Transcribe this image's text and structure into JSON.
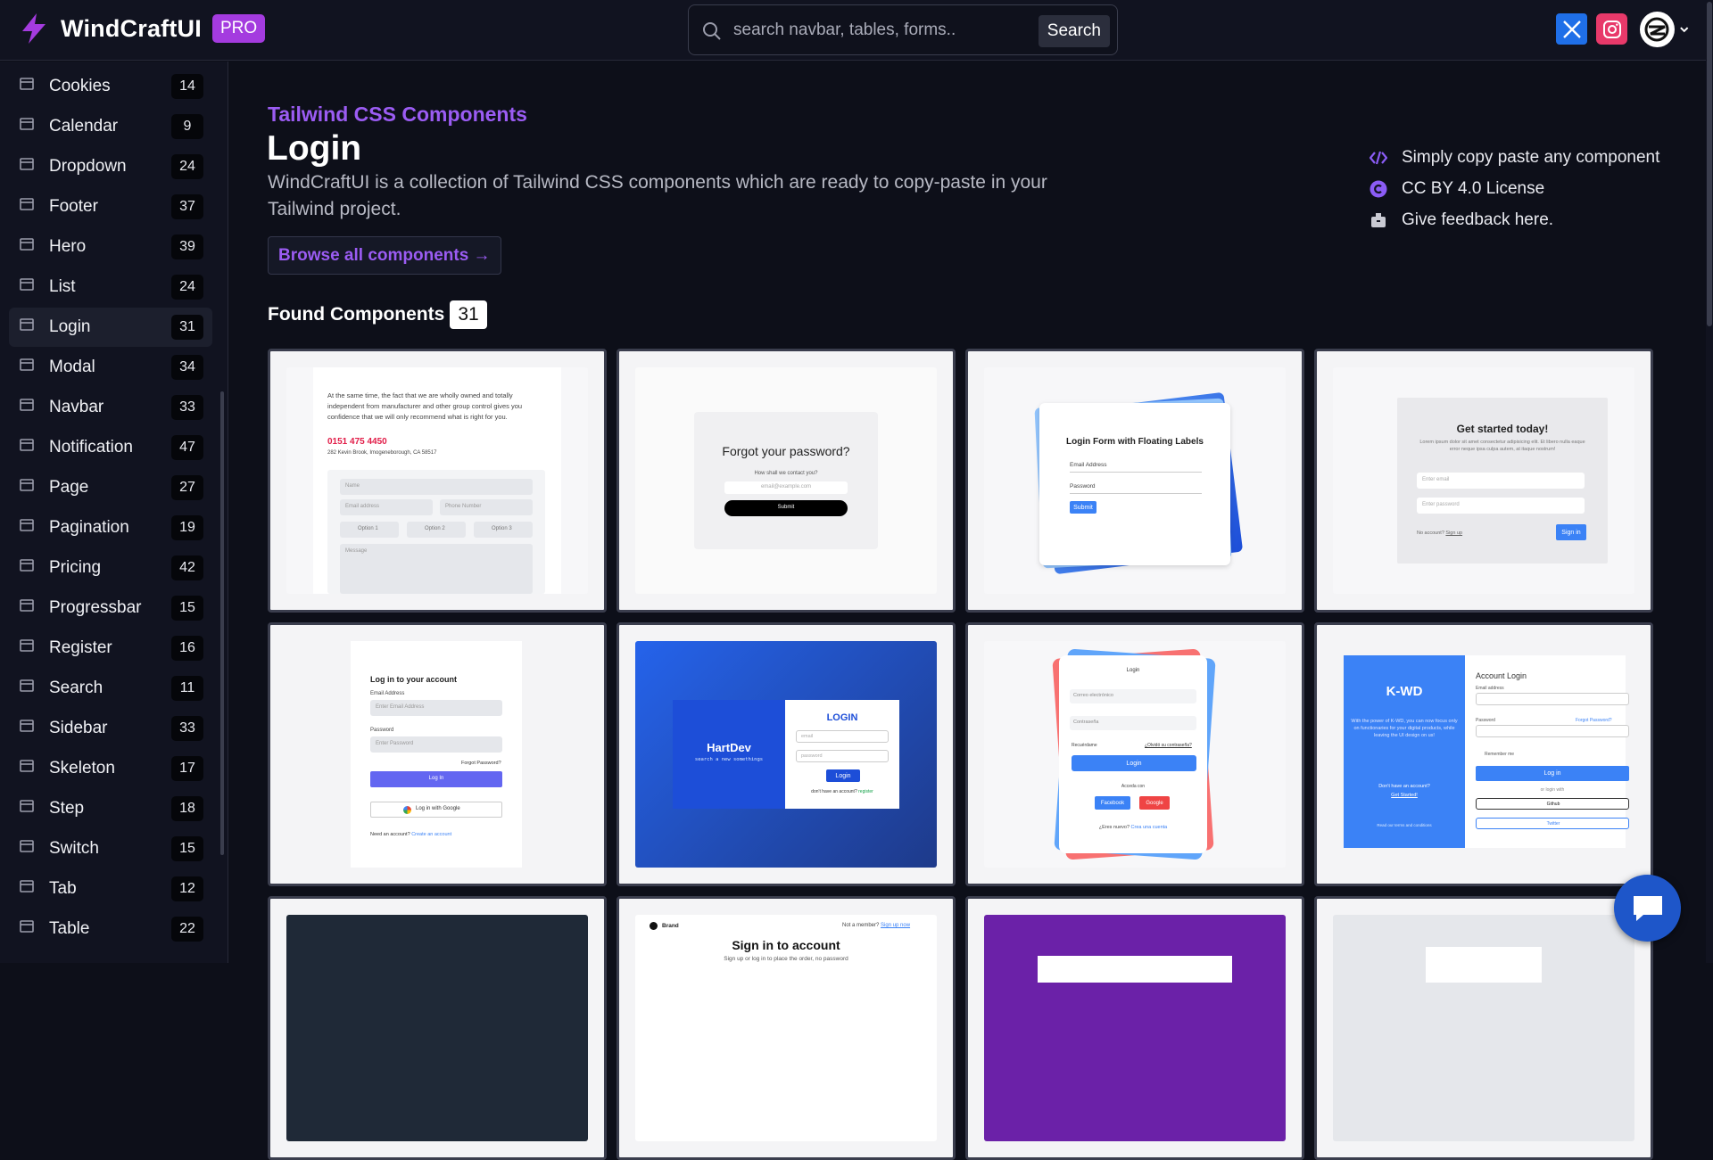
{
  "app": {
    "brand_name": "WindCraftUI",
    "pro_label": "PRO",
    "search_placeholder": "search navbar, tables, forms..",
    "search_button": "Search"
  },
  "sidebar": {
    "items": [
      {
        "label": "Cookies",
        "count": "14"
      },
      {
        "label": "Calendar",
        "count": "9"
      },
      {
        "label": "Dropdown",
        "count": "24"
      },
      {
        "label": "Footer",
        "count": "37"
      },
      {
        "label": "Hero",
        "count": "39"
      },
      {
        "label": "List",
        "count": "24"
      },
      {
        "label": "Login",
        "count": "31",
        "active": true
      },
      {
        "label": "Modal",
        "count": "34"
      },
      {
        "label": "Navbar",
        "count": "33"
      },
      {
        "label": "Notification",
        "count": "47"
      },
      {
        "label": "Page",
        "count": "27"
      },
      {
        "label": "Pagination",
        "count": "19"
      },
      {
        "label": "Pricing",
        "count": "42"
      },
      {
        "label": "Progressbar",
        "count": "15"
      },
      {
        "label": "Register",
        "count": "16"
      },
      {
        "label": "Search",
        "count": "11"
      },
      {
        "label": "Sidebar",
        "count": "33"
      },
      {
        "label": "Skeleton",
        "count": "17"
      },
      {
        "label": "Step",
        "count": "18"
      },
      {
        "label": "Switch",
        "count": "15"
      },
      {
        "label": "Tab",
        "count": "12"
      },
      {
        "label": "Table",
        "count": "22"
      }
    ]
  },
  "main": {
    "kicker": "Tailwind CSS Components",
    "title": "Login",
    "description": "WindCraftUI is a collection of Tailwind CSS components which are ready to copy-paste in your Tailwind project.",
    "browse_label": "Browse all components →",
    "features": [
      "Simply copy paste any component",
      "CC BY 4.0 License",
      "Give feedback here."
    ],
    "found_label": "Found Components",
    "found_count": "31"
  },
  "cards": {
    "c1": {
      "text": "At the same time, the fact that we are wholly owned and totally independent from manufacturer and other group control gives you confidence that we will only recommend what is right for you.",
      "phone": "0151 475 4450",
      "address": "282 Kevin Brook, Imogeneborough, CA 58517",
      "name": "Name",
      "email": "Email address",
      "phone_field": "Phone Number",
      "opt1": "Option 1",
      "opt2": "Option 2",
      "opt3": "Option 3",
      "message": "Message"
    },
    "c2": {
      "title": "Forgot your password?",
      "hint": "How shall we contact you?",
      "input": "email@example.com",
      "submit": "Submit"
    },
    "c3": {
      "title": "Login Form with Floating Labels",
      "email": "Email Address",
      "password": "Password",
      "submit": "Submit"
    },
    "c4": {
      "title": "Get started today!",
      "text": "Lorem ipsum dolor sit amet consectetur adipisicing elit. Et libero nulla eaque error neque ipsa culpa autem, at itaque nostrum!",
      "email": "Enter email",
      "password": "Enter password",
      "no_account": "No account?",
      "sign_up": "Sign up",
      "sign_in": "Sign in"
    },
    "c5": {
      "title": "Log in to your account",
      "email_label": "Email Address",
      "email_ph": "Enter Email Address",
      "password_label": "Password",
      "password_ph": "Enter Password",
      "forgot": "Forgot Password?",
      "login": "Log In",
      "google": "Log in with Google",
      "need": "Need an account?",
      "create": "Create an account"
    },
    "c6": {
      "brand": "HartDev",
      "tagline": "search a new somethings",
      "title": "LOGIN",
      "email": "email",
      "password": "password",
      "login": "Login",
      "no_account": "don't have an account?",
      "register": "register"
    },
    "c7": {
      "title": "Login",
      "email": "Correo electrónico",
      "password": "Contraseña",
      "remember": "Recuérdame",
      "forgot": "¿Olvidó su contraseña?",
      "login": "Login",
      "access": "Acceda con",
      "facebook": "Facebook",
      "google": "Google",
      "new": "¿Eres nuevo?",
      "create": "Crea una cuenta"
    },
    "c8": {
      "brand": "K-WD",
      "text": "With the power of K-WD, you can now focus only on functionaries for your digital products, while leaving the UI design on us!",
      "no_account": "Don't have an account?",
      "get_started": "Get Started!",
      "read": "Read our terms and conditions",
      "title": "Account Login",
      "email": "Email address",
      "password": "Password",
      "forgot": "Forgot Password?",
      "remember": "Remember me",
      "login": "Log in",
      "or": "or login with",
      "github": "Github",
      "twitter": "Twitter"
    },
    "c10": {
      "brand": "Brand",
      "member": "Not a member?",
      "sign_up": "Sign up now",
      "title": "Sign in to account",
      "sub": "Sign up or log in to place the order, no password"
    }
  }
}
